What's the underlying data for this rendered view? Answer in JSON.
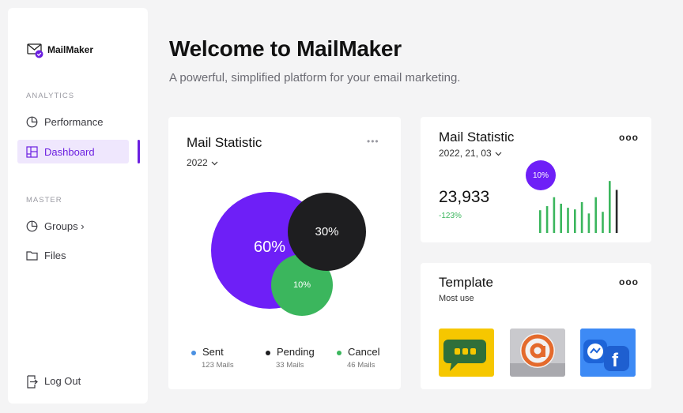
{
  "brand": {
    "name": "MailMaker"
  },
  "sidebar": {
    "analytics_label": "ANALYTICS",
    "master_label": "MASTER",
    "items": [
      {
        "label": "Performance",
        "icon": "pie-chart-icon"
      },
      {
        "label": "Dashboard",
        "icon": "dashboard-icon"
      },
      {
        "label": "Groups ›",
        "icon": "pie-chart-icon"
      },
      {
        "label": "Files",
        "icon": "folder-icon"
      }
    ],
    "logout_label": "Log Out"
  },
  "header": {
    "title": "Welcome to MailMaker",
    "subtitle": "A powerful, simplified platform for your email marketing."
  },
  "mail_stat_card": {
    "title": "Mail Statistic",
    "year": "2022",
    "menu": "•••",
    "bubbles": [
      {
        "label": "60%",
        "color": "#6e1ff7"
      },
      {
        "label": "30%",
        "color": "#1e1e20"
      },
      {
        "label": "10%",
        "color": "#3bb65d"
      }
    ],
    "legend": [
      {
        "name": "Sent",
        "sub": "123 Mails",
        "color": "#4a90e2"
      },
      {
        "name": "Pending",
        "sub": "33 Mails",
        "color": "#1e1e20"
      },
      {
        "name": "Cancel",
        "sub": "46 Mails",
        "color": "#3bb65d"
      }
    ]
  },
  "mail_stat_small": {
    "title": "Mail Statistic",
    "date": "2022, 21, 03",
    "menu": "ooo",
    "badge": "10%",
    "value": "23,933",
    "change": "-123%",
    "bars": [
      28,
      33,
      44,
      36,
      31,
      29,
      38,
      24,
      44,
      26,
      64,
      53
    ]
  },
  "template_card": {
    "title": "Template",
    "subtitle": "Most use",
    "menu": "ooo",
    "thumbs": [
      {
        "name": "chat-template",
        "bg": "#f6c700"
      },
      {
        "name": "at-sign-template",
        "bg": "#bfbfc4"
      },
      {
        "name": "messenger-facebook-template",
        "bg": "#2d7df0"
      }
    ]
  },
  "colors": {
    "accent": "#6b1fe0",
    "green": "#3bb65d",
    "dark": "#1e1e20"
  }
}
